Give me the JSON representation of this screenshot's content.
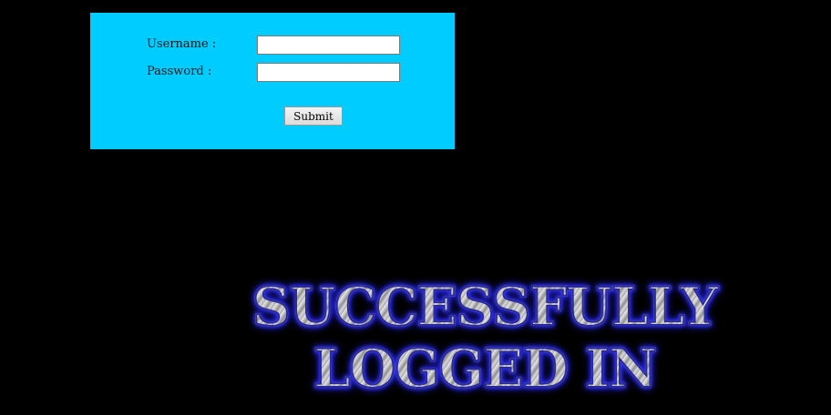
{
  "login_form": {
    "username_label": "Username :",
    "password_label": "Password :",
    "username_value": "",
    "password_value": "",
    "submit_label": "Submit"
  },
  "banner": {
    "line1": "SUCCESSFULLY",
    "line2": "LOGGED IN"
  },
  "colors": {
    "page_background": "#000000",
    "panel_background": "#00ccff",
    "banner_glow": "#2222ff",
    "banner_fill": "#bdbdbd"
  }
}
